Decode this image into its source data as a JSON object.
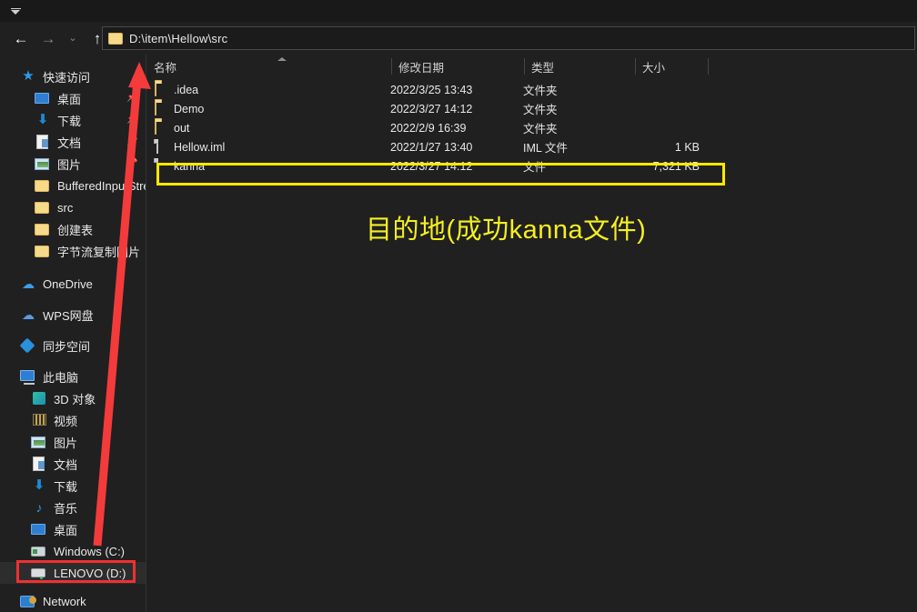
{
  "window": {
    "title_bar": {
      "quick_access_toolbar_icon": "customize-quick-access-chevron-icon"
    }
  },
  "nav": {
    "back_icon": "back-arrow-icon",
    "forward_icon": "forward-arrow-icon",
    "recent_icon": "recent-locations-chevron-icon",
    "up_icon": "up-arrow-icon",
    "address_folder_icon": "folder-icon",
    "address_path": "D:\\item\\Hellow\\src"
  },
  "sidebar": {
    "groups": [
      {
        "name": "quick-access",
        "header": {
          "label": "快速访问",
          "icon": "star-icon"
        },
        "items": [
          {
            "label": "桌面",
            "icon": "desktop-icon",
            "pinned": true,
            "indent": 1
          },
          {
            "label": "下载",
            "icon": "download-icon",
            "pinned": true,
            "indent": 1
          },
          {
            "label": "文档",
            "icon": "documents-icon",
            "pinned": true,
            "indent": 1
          },
          {
            "label": "图片",
            "icon": "pictures-icon",
            "pinned": true,
            "indent": 1
          },
          {
            "label": "BufferedInputStre",
            "icon": "folder-icon",
            "pinned": false,
            "indent": 1
          },
          {
            "label": "src",
            "icon": "folder-icon",
            "pinned": false,
            "indent": 1
          },
          {
            "label": "创建表",
            "icon": "folder-icon",
            "pinned": false,
            "indent": 1
          },
          {
            "label": "字节流复制图片",
            "icon": "folder-icon",
            "pinned": false,
            "indent": 1
          }
        ]
      },
      {
        "name": "cloud",
        "items": [
          {
            "label": "OneDrive",
            "icon": "onedrive-cloud-icon",
            "indent": 0
          },
          {
            "label": "WPS网盘",
            "icon": "wps-cloud-icon",
            "indent": 0
          },
          {
            "label": "同步空间",
            "icon": "sync-diamond-icon",
            "indent": 0
          }
        ]
      },
      {
        "name": "this-pc",
        "header": {
          "label": "此电脑",
          "icon": "this-pc-icon"
        },
        "items": [
          {
            "label": "3D 对象",
            "icon": "3d-objects-icon",
            "indent": 1
          },
          {
            "label": "视频",
            "icon": "videos-icon",
            "indent": 1
          },
          {
            "label": "图片",
            "icon": "pictures-icon",
            "indent": 1
          },
          {
            "label": "文档",
            "icon": "documents-icon",
            "indent": 1
          },
          {
            "label": "下载",
            "icon": "download-icon",
            "indent": 1
          },
          {
            "label": "音乐",
            "icon": "music-icon",
            "indent": 1
          },
          {
            "label": "桌面",
            "icon": "desktop-icon",
            "indent": 1
          },
          {
            "label": "Windows (C:)",
            "icon": "windows-drive-icon",
            "indent": 1
          },
          {
            "label": "LENOVO (D:)",
            "icon": "drive-icon",
            "indent": 1,
            "selected": true
          }
        ]
      },
      {
        "name": "network",
        "items": [
          {
            "label": "Network",
            "icon": "network-icon",
            "indent": 0
          }
        ]
      }
    ]
  },
  "filelist": {
    "columns": [
      {
        "key": "name",
        "label": "名称",
        "sorted": "asc"
      },
      {
        "key": "date",
        "label": "修改日期"
      },
      {
        "key": "type",
        "label": "类型"
      },
      {
        "key": "size",
        "label": "大小"
      }
    ],
    "rows": [
      {
        "name": ".idea",
        "date": "2022/3/25 13:43",
        "type": "文件夹",
        "size": "",
        "icon": "folder-icon",
        "selected": false
      },
      {
        "name": "Demo",
        "date": "2022/3/27 14:12",
        "type": "文件夹",
        "size": "",
        "icon": "folder-icon",
        "selected": false
      },
      {
        "name": "out",
        "date": "2022/2/9 16:39",
        "type": "文件夹",
        "size": "",
        "icon": "folder-icon",
        "selected": false
      },
      {
        "name": "Hellow.iml",
        "date": "2022/1/27 13:40",
        "type": "IML 文件",
        "size": "1 KB",
        "icon": "file-icon",
        "selected": false
      },
      {
        "name": "kanna",
        "date": "2022/3/27 14:12",
        "type": "文件",
        "size": "7,321 KB",
        "icon": "file-icon",
        "selected": true
      }
    ]
  },
  "annotations": {
    "caption": "目的地(成功kanna文件)",
    "highlight_box_color": "#ffe800",
    "sidebar_box_color": "#f03030",
    "arrow_color": "#f33b3b",
    "caption_color": "#f5ef22"
  }
}
